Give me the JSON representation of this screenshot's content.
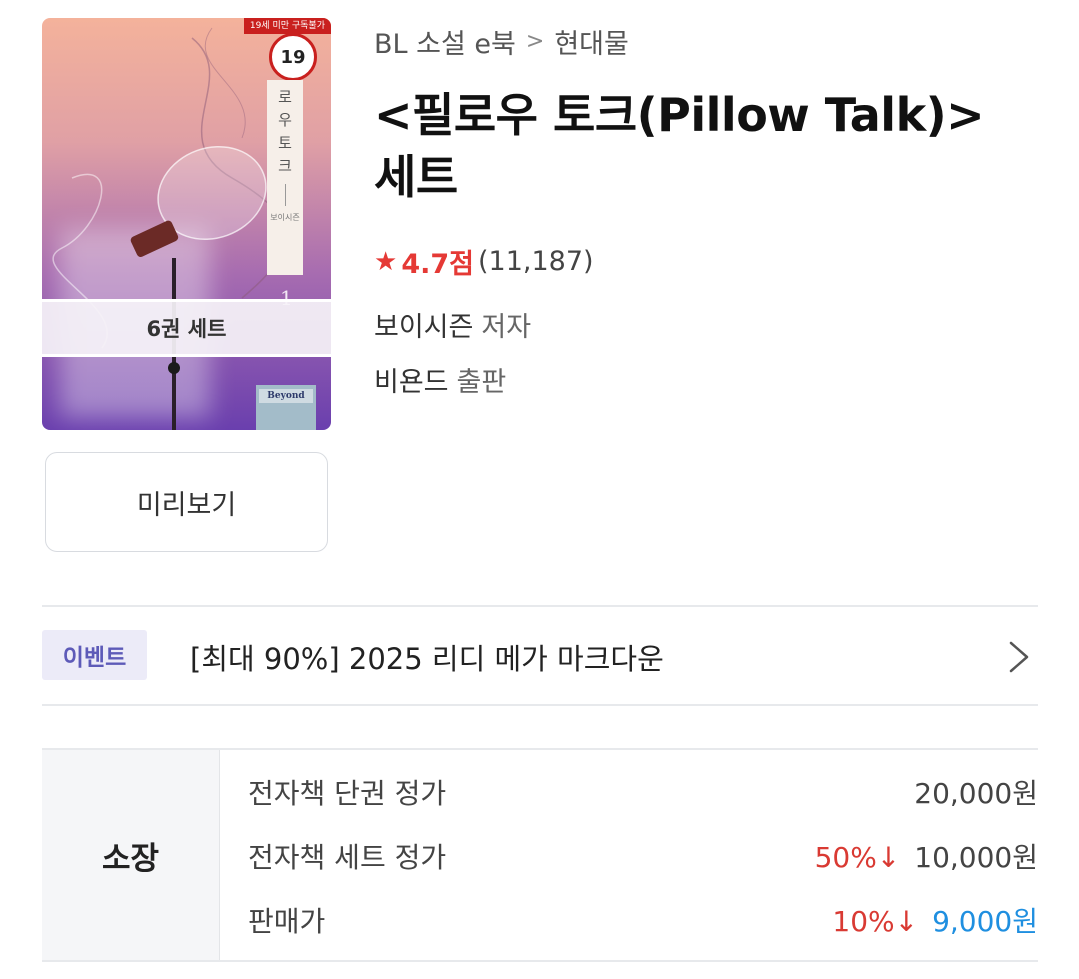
{
  "cover": {
    "age_strip": "19세 미만 구독불가",
    "age_badge": "19",
    "title_chars": [
      "로",
      "우",
      "토",
      "크"
    ],
    "author_small": "보이시즌",
    "volume_number": "1",
    "set_label": "6권 세트",
    "publisher_logo": "Beyond"
  },
  "preview": {
    "label": "미리보기"
  },
  "breadcrumb": {
    "category": "BL 소설 e북",
    "separator": ">",
    "subcategory": "현대물"
  },
  "book": {
    "title_line1": "<필로우 토크(Pillow Talk)>",
    "title_line2": "세트",
    "rating_score": "4.7점",
    "rating_count": "(11,187)",
    "author_name": "보이시즌",
    "author_role": "저자",
    "publisher_name": "비욘드",
    "publisher_role": "출판"
  },
  "event": {
    "badge": "이벤트",
    "text": "[최대 90%] 2025 리디 메가 마크다운"
  },
  "price": {
    "own_label": "소장",
    "rows": [
      {
        "label": "전자책 단권 정가",
        "discount": "",
        "value": "20,000원"
      },
      {
        "label": "전자책 세트 정가",
        "discount": "50%↓",
        "value": "10,000원"
      },
      {
        "label": "판매가",
        "discount": "10%↓",
        "value": "9,000원"
      }
    ]
  },
  "colors": {
    "accent_red": "#e53935",
    "price_blue": "#1f8fe0",
    "event_purple": "#5d5ab8"
  }
}
